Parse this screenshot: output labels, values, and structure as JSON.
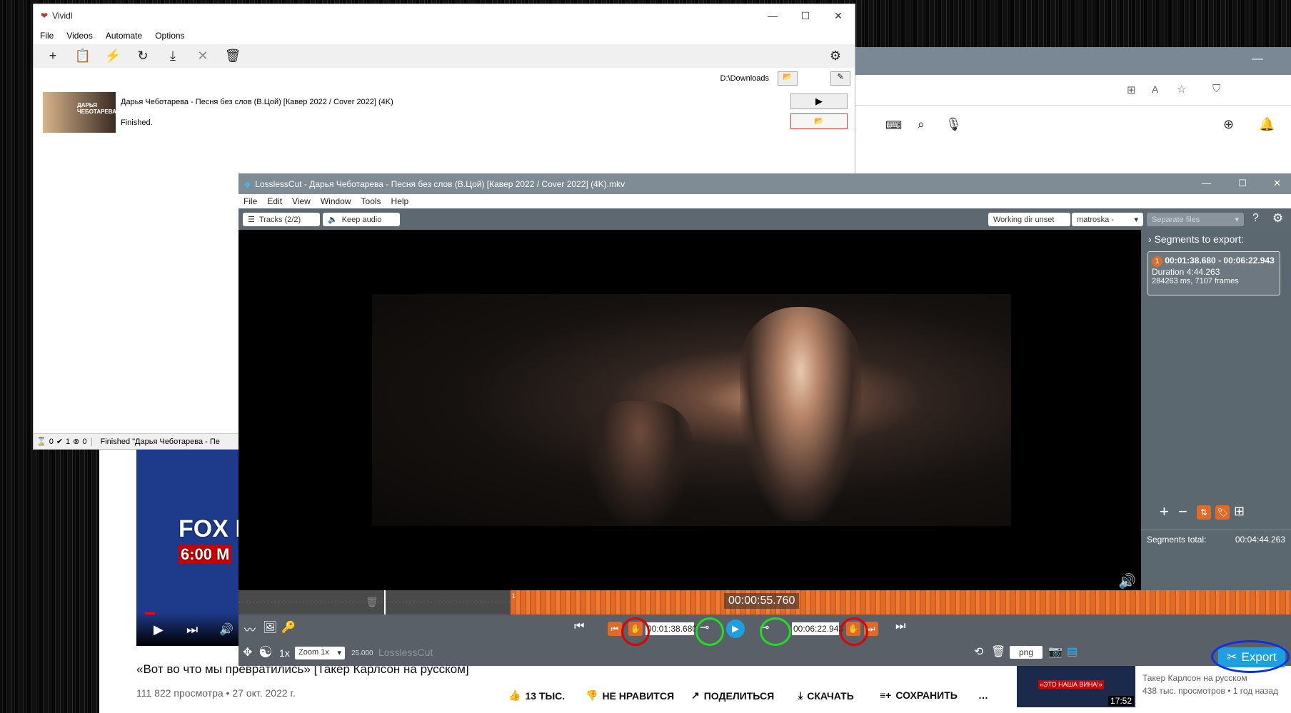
{
  "vividl": {
    "title": "Vividl",
    "menu": [
      "File",
      "Videos",
      "Automate",
      "Options"
    ],
    "path": "D:\\Downloads",
    "item": {
      "title": "Дарья Чеботарева - Песня без слов (В.Цой) [Кавер 2022 / Cover 2022] (4K)",
      "status": "Finished.",
      "thumb_text": "ДАРЬЯ ЧЕБОТАРЕВА"
    },
    "statusbar": {
      "pending": "0",
      "done": "1",
      "failed": "0",
      "message": "Finished \"Дарья Чеботарева - Пе"
    }
  },
  "lossless": {
    "title": "LosslessCut - Дарья Чеботарева - Песня без слов (В.Цой) [Кавер 2022 / Cover 2022] (4K).mkv",
    "menu": [
      "File",
      "Edit",
      "View",
      "Window",
      "Tools",
      "Help"
    ],
    "tracks": "Tracks (2/2)",
    "keep_audio": "Keep audio",
    "working_dir": "Working dir unset",
    "format": "matroska -",
    "output_mode": "Separate files",
    "segments_header": "Segments to export:",
    "segment": {
      "index": "1",
      "range": "00:01:38.680 - 00:06:22.943",
      "duration": "Duration 4:44.263",
      "details": "284263 ms, 7107 frames"
    },
    "segments_total_label": "Segments total:",
    "segments_total": "00:04:44.263",
    "current_time": "00:00:55.760",
    "cut_start": "00:01:38.680",
    "cut_end": "00:06:22.943",
    "speed": "1x",
    "zoom": "Zoom 1x",
    "fps": "25.000",
    "brand": "LosslessCut",
    "snapshot_format": "png",
    "export_label": "Export",
    "segment_marker": "1"
  },
  "youtube": {
    "video_title": "«Вот во что мы превратились» [Такер Карлсон на русском]",
    "meta": "111 822 просмотра • 27 окт. 2022 г.",
    "likes": "13 ТЫС.",
    "dislike": "НЕ НРАВИТСЯ",
    "share": "ПОДЕЛИТЬСЯ",
    "download": "СКАЧАТЬ",
    "save": "СОХРАНИТЬ",
    "news_text": "FOX NEWS",
    "news_time": "6:00 M",
    "rec_title": "Такер Карлсон на русском",
    "rec_meta": "438 тыс. просмотров • 1 год назад",
    "rec_duration": "17:52",
    "rec_caption": "«ЭТО НАША ВИНА!»"
  },
  "colors": {
    "accent_orange": "#e06a28",
    "export_blue": "#1ea0e0",
    "highlight_red": "#e00000",
    "highlight_green": "#22dd22",
    "highlight_blue": "#1030e0"
  }
}
